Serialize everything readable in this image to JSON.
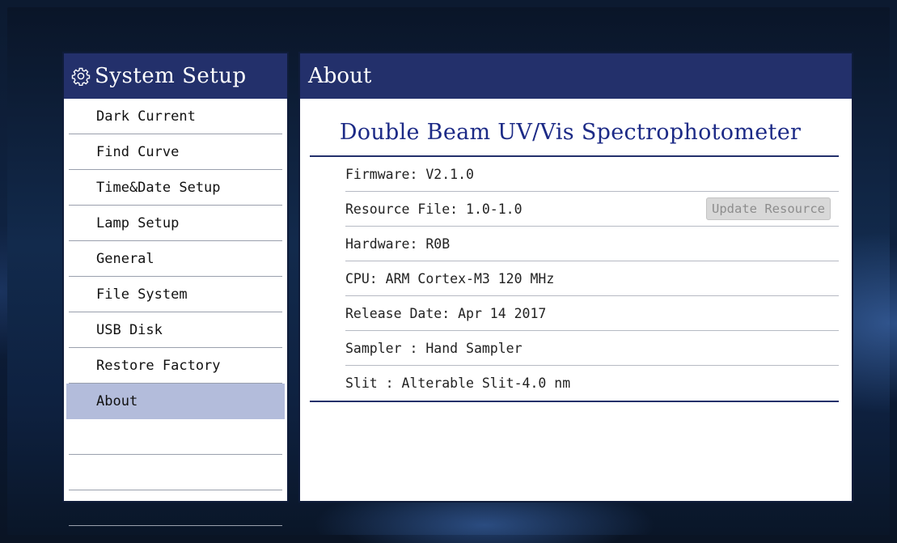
{
  "left": {
    "title": "System Setup",
    "items": [
      {
        "label": "Dark Current",
        "active": false
      },
      {
        "label": "Find Curve",
        "active": false
      },
      {
        "label": "Time&Date Setup",
        "active": false
      },
      {
        "label": "Lamp Setup",
        "active": false
      },
      {
        "label": "General",
        "active": false
      },
      {
        "label": "File System",
        "active": false
      },
      {
        "label": "USB Disk",
        "active": false
      },
      {
        "label": "Restore Factory",
        "active": false
      },
      {
        "label": "About",
        "active": true
      },
      {
        "label": "",
        "active": false
      },
      {
        "label": "",
        "active": false
      },
      {
        "label": "",
        "active": false
      }
    ]
  },
  "right": {
    "title": "About",
    "product_title": "Double Beam UV/Vis Spectrophotometer",
    "rows": [
      {
        "text": "Firmware: V2.1.0"
      },
      {
        "text": "Resource File: 1.0-1.0",
        "button": "Update Resource"
      },
      {
        "text": "Hardware: R0B"
      },
      {
        "text": "CPU: ARM Cortex-M3 120 MHz"
      },
      {
        "text": "Release Date: Apr 14 2017"
      },
      {
        "text": "Sampler : Hand Sampler"
      },
      {
        "text": "Slit : Alterable Slit-4.0 nm"
      }
    ]
  },
  "colors": {
    "header_bg": "#23306b",
    "active_item_bg": "#b3bcdb",
    "title_text": "#1c2a86",
    "disabled_button_bg": "#d8d8d8"
  },
  "icons": {
    "left_header": "gear-icon"
  }
}
